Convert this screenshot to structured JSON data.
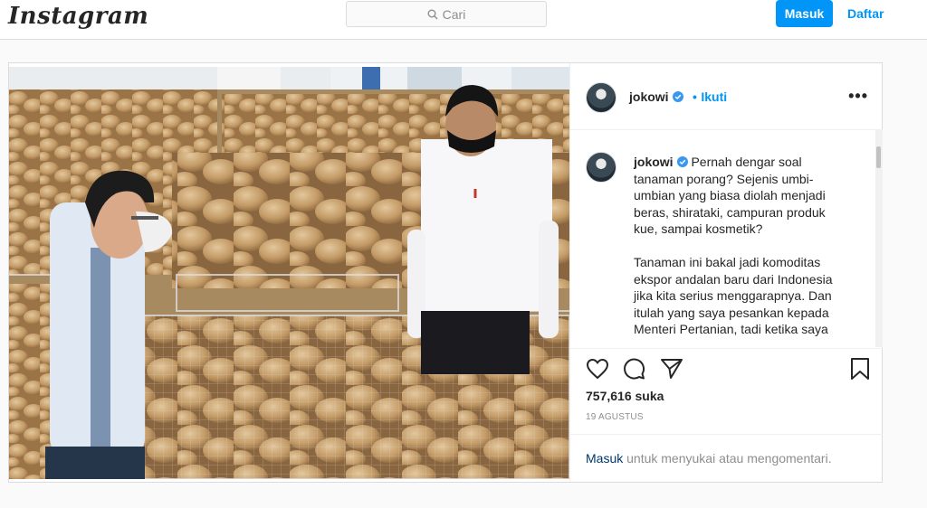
{
  "header": {
    "logo_text": "Instagram",
    "search_placeholder": "Cari",
    "login_label": "Masuk",
    "signup_label": "Daftar"
  },
  "post": {
    "username": "jokowi",
    "follow_label": "Ikuti",
    "follow_separator": "•",
    "more_label": "•••",
    "caption": "Pernah dengar soal tanaman porang? Sejenis umbi-umbian yang biasa diolah menjadi beras, shirataki, campuran produk kue, sampai kosmetik?\n\nTanaman ini bakal jadi komoditas ekspor andalan baru dari Indonesia jika kita serius menggarapnya. Dan itulah yang saya pesankan kepada Menteri Pertanian, tadi ketika saya",
    "likes": "757,616 suka",
    "date": "19 AGUSTUS",
    "login_prompt_link": "Masuk",
    "login_prompt_rest": " untuk menyukai atau mengomentari."
  },
  "colors": {
    "accent": "#0095f6",
    "border": "#dbdbdb",
    "text": "#262626",
    "muted": "#8e8e8e"
  }
}
